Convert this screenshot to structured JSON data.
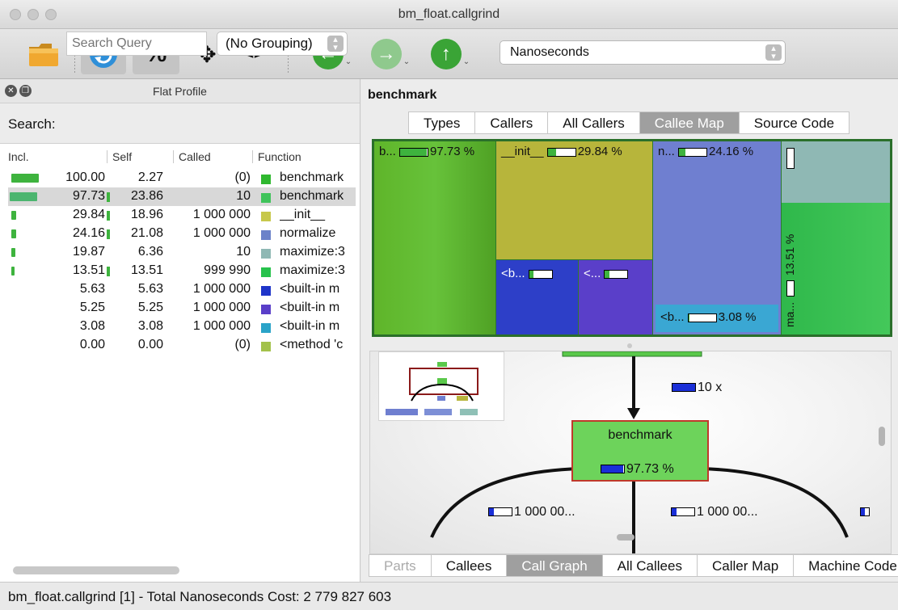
{
  "window": {
    "title": "bm_float.callgrind"
  },
  "toolbar": {
    "percent_label": "%",
    "move_label": "✥",
    "code_label": "<>",
    "event_select": "Nanoseconds"
  },
  "flat_profile": {
    "title": "Flat Profile",
    "search_label": "Search:",
    "search_placeholder": "Search Query",
    "grouping": "(No Grouping)",
    "columns": {
      "incl": "Incl.",
      "self": "Self",
      "called": "Called",
      "function": "Function"
    },
    "rows": [
      {
        "incl": "100.00",
        "self": "2.27",
        "called": "(0)",
        "function": "benchmark",
        "color": "#2fb82f"
      },
      {
        "incl": "97.73",
        "self": "23.86",
        "called": "10",
        "function": "benchmark",
        "color": "#3fc35a"
      },
      {
        "incl": "29.84",
        "self": "18.96",
        "called": "1 000 000",
        "function": "__init__",
        "color": "#c7c84b"
      },
      {
        "incl": "24.16",
        "self": "21.08",
        "called": "1 000 000",
        "function": "normalize",
        "color": "#6b82c9"
      },
      {
        "incl": "19.87",
        "self": "6.36",
        "called": "10",
        "function": "maximize:3",
        "color": "#8fb8b4"
      },
      {
        "incl": "13.51",
        "self": "13.51",
        "called": "999 990",
        "function": "maximize:3",
        "color": "#27c24c"
      },
      {
        "incl": "5.63",
        "self": "5.63",
        "called": "1 000 000",
        "function": "<built-in m",
        "color": "#1f35c9"
      },
      {
        "incl": "5.25",
        "self": "5.25",
        "called": "1 000 000",
        "function": "<built-in m",
        "color": "#5a3fc9"
      },
      {
        "incl": "3.08",
        "self": "3.08",
        "called": "1 000 000",
        "function": "<built-in m",
        "color": "#2aa3c8"
      },
      {
        "incl": "0.00",
        "self": "0.00",
        "called": "(0)",
        "function": "<method 'c",
        "color": "#a3c24b"
      }
    ]
  },
  "detail": {
    "title": "benchmark",
    "top_tabs": [
      "Types",
      "Callers",
      "All Callers",
      "Callee Map",
      "Source Code"
    ],
    "top_active": "Callee Map",
    "map": {
      "b": {
        "label": "b...",
        "pct": "97.73 %"
      },
      "init": {
        "label": "__init__",
        "pct": "29.84 %"
      },
      "n": {
        "label": "n...",
        "pct": "24.16 %"
      },
      "b2": {
        "label": "<b...",
        "pct": ""
      },
      "lt": {
        "label": "<...",
        "pct": ""
      },
      "b3": {
        "label": "<b...",
        "pct": "3.08 %"
      },
      "vertical_pct": "13.51 %",
      "ma": "ma..."
    },
    "graph": {
      "node_label": "benchmark",
      "node_pct": "97.73 %",
      "edge_calls": "10 x",
      "edge_left": "1 000 00...",
      "edge_mid": "1 000 00..."
    },
    "bottom_tabs": [
      "Parts",
      "Callees",
      "Call Graph",
      "All Callees",
      "Caller Map",
      "Machine Code"
    ],
    "bottom_active": "Call Graph"
  },
  "status": {
    "text": "bm_float.callgrind [1] - Total Nanoseconds Cost: 2 779 827 603"
  }
}
